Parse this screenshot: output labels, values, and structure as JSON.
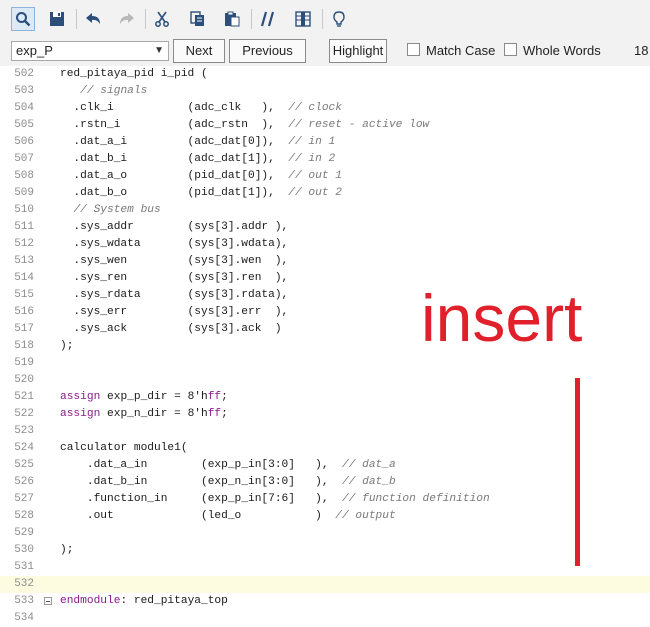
{
  "toolbar": {
    "icons": [
      "search-icon",
      "save-icon",
      "undo-icon",
      "redo-icon",
      "cut-icon",
      "copy-icon",
      "paste-icon",
      "comment-icon",
      "column-icon",
      "bulb-icon"
    ]
  },
  "findbar": {
    "search_value": "exp_P",
    "next_label": "Next",
    "previous_label": "Previous",
    "highlight_label": "Highlight",
    "match_case_label": "Match Case",
    "whole_words_label": "Whole Words",
    "count": "18"
  },
  "annotation": {
    "text": "insert",
    "color": "#e0202a"
  },
  "lines": [
    {
      "n": "502",
      "segs": [
        {
          "t": "red_pitaya_pid i_pid ("
        }
      ]
    },
    {
      "n": "503",
      "segs": [
        {
          "t": "   "
        },
        {
          "t": "// signals",
          "c": "cm"
        }
      ]
    },
    {
      "n": "504",
      "segs": [
        {
          "t": "  .clk_i           (adc_clk   ),  "
        },
        {
          "t": "// clock",
          "c": "cm"
        }
      ]
    },
    {
      "n": "505",
      "segs": [
        {
          "t": "  .rstn_i          (adc_rstn  ),  "
        },
        {
          "t": "// reset - active low",
          "c": "cm"
        }
      ]
    },
    {
      "n": "506",
      "segs": [
        {
          "t": "  .dat_a_i         (adc_dat[0]),  "
        },
        {
          "t": "// in 1",
          "c": "cm"
        }
      ]
    },
    {
      "n": "507",
      "segs": [
        {
          "t": "  .dat_b_i         (adc_dat[1]),  "
        },
        {
          "t": "// in 2",
          "c": "cm"
        }
      ]
    },
    {
      "n": "508",
      "segs": [
        {
          "t": "  .dat_a_o         (pid_dat[0]),  "
        },
        {
          "t": "// out 1",
          "c": "cm"
        }
      ]
    },
    {
      "n": "509",
      "segs": [
        {
          "t": "  .dat_b_o         (pid_dat[1]),  "
        },
        {
          "t": "// out 2",
          "c": "cm"
        }
      ]
    },
    {
      "n": "510",
      "segs": [
        {
          "t": "  "
        },
        {
          "t": "// System bus",
          "c": "cm"
        }
      ]
    },
    {
      "n": "511",
      "segs": [
        {
          "t": "  .sys_addr        (sys[3].addr ),"
        }
      ]
    },
    {
      "n": "512",
      "segs": [
        {
          "t": "  .sys_wdata       (sys[3].wdata),"
        }
      ]
    },
    {
      "n": "513",
      "segs": [
        {
          "t": "  .sys_wen         (sys[3].wen  ),"
        }
      ]
    },
    {
      "n": "514",
      "segs": [
        {
          "t": "  .sys_ren         (sys[3].ren  ),"
        }
      ]
    },
    {
      "n": "515",
      "segs": [
        {
          "t": "  .sys_rdata       (sys[3].rdata),"
        }
      ]
    },
    {
      "n": "516",
      "segs": [
        {
          "t": "  .sys_err         (sys[3].err  ),"
        }
      ]
    },
    {
      "n": "517",
      "segs": [
        {
          "t": "  .sys_ack         (sys[3].ack  )"
        }
      ]
    },
    {
      "n": "518",
      "segs": [
        {
          "t": ");"
        }
      ]
    },
    {
      "n": "519",
      "segs": []
    },
    {
      "n": "520",
      "segs": []
    },
    {
      "n": "521",
      "segs": [
        {
          "t": "assign",
          "c": "kw"
        },
        {
          "t": " exp_p_dir = 8'h"
        },
        {
          "t": "ff",
          "c": "kw"
        },
        {
          "t": ";"
        }
      ]
    },
    {
      "n": "522",
      "segs": [
        {
          "t": "assign",
          "c": "kw"
        },
        {
          "t": " exp_n_dir = 8'h"
        },
        {
          "t": "ff",
          "c": "kw"
        },
        {
          "t": ";"
        }
      ]
    },
    {
      "n": "523",
      "segs": []
    },
    {
      "n": "524",
      "segs": [
        {
          "t": "calculator module1("
        }
      ]
    },
    {
      "n": "525",
      "segs": [
        {
          "t": "    .dat_a_in        (exp_p_in[3:0]   ),  "
        },
        {
          "t": "// dat_a",
          "c": "cm"
        }
      ]
    },
    {
      "n": "526",
      "segs": [
        {
          "t": "    .dat_b_in        (exp_n_in[3:0]   ),  "
        },
        {
          "t": "// dat_b",
          "c": "cm"
        }
      ]
    },
    {
      "n": "527",
      "segs": [
        {
          "t": "    .function_in     (exp_p_in[7:6]   ),  "
        },
        {
          "t": "// function definition",
          "c": "cm"
        }
      ]
    },
    {
      "n": "528",
      "segs": [
        {
          "t": "    .out             (led_o           )  "
        },
        {
          "t": "// output",
          "c": "cm"
        }
      ]
    },
    {
      "n": "529",
      "segs": []
    },
    {
      "n": "530",
      "segs": [
        {
          "t": ");"
        }
      ]
    },
    {
      "n": "531",
      "segs": []
    },
    {
      "n": "532",
      "segs": [],
      "current": true
    },
    {
      "n": "533",
      "segs": [
        {
          "t": "endmodule",
          "c": "kw"
        },
        {
          "t": ": red_pitaya_top"
        }
      ],
      "fold": true
    },
    {
      "n": "534",
      "segs": []
    }
  ]
}
